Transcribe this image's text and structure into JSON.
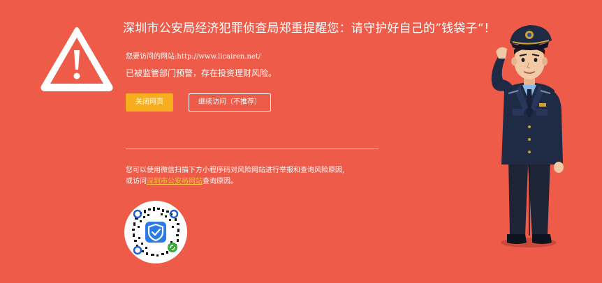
{
  "headline": "深圳市公安局经济犯罪侦查局郑重提醒您：请守护好自己的”钱袋子“！",
  "visit": {
    "prefix": "您要访问的网站:",
    "url": "http://www.licairen.net/"
  },
  "warning_text": "已被监管部门预警，存在投资理财风险。",
  "buttons": {
    "close_label": "关闭网页",
    "continue_label": "继续访问（不推荐）"
  },
  "report": {
    "line1": "您可以使用微信扫描下方小程序码对风险网站进行举报和查询风险原因,",
    "line2_prefix": "或访问",
    "link_text": "深圳市公安局网站",
    "line2_suffix": "查询原因。"
  },
  "icons": {
    "warning": "warning-triangle-icon",
    "qr": "wechat-mini-program-qr-code",
    "shield": "shield-check-icon",
    "police": "saluting-police-officer-illustration"
  },
  "colors": {
    "background": "#ee5b48",
    "close_button": "#f6ae1f",
    "link": "#f6c343",
    "uniform": "#1f2b45",
    "shield_blue": "#2b7be4",
    "wechat_green": "#3aaa3a"
  }
}
